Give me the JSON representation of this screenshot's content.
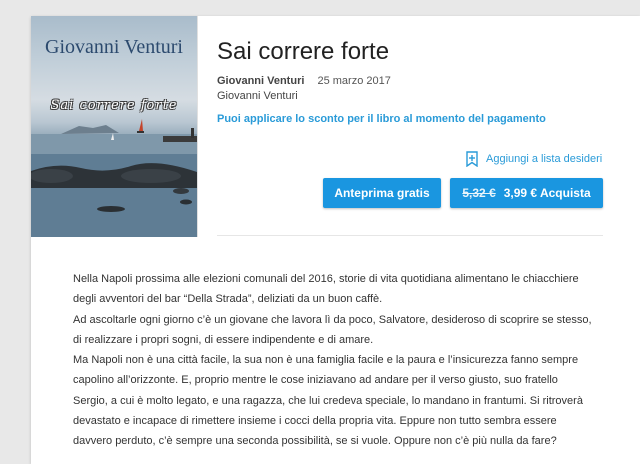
{
  "book": {
    "cover": {
      "author": "Giovanni Venturi",
      "title": "Sai correre forte"
    },
    "title": "Sai correre forte",
    "author": "Giovanni Venturi",
    "date": "25 marzo 2017",
    "publisher": "Giovanni Venturi",
    "promo": "Puoi applicare lo sconto per il libro al momento del pagamento"
  },
  "actions": {
    "wishlist": "Aggiungi a lista desideri",
    "preview": "Anteprima gratis",
    "old_price": "5,32 €",
    "buy": "3,99 € Acquista"
  },
  "description": [
    "Nella Napoli prossima alle elezioni comunali del 2016, storie di vita quotidiana alimentano le chiacchiere degli avventori del bar “Della Strada”, deliziati da un buon caffè.",
    "Ad ascoltarle ogni giorno c’è un giovane che lavora lì da poco, Salvatore, desideroso di scoprire se stesso, di realizzare i propri sogni, di essere indipendente e di amare.",
    "Ma Napoli non è una città facile, la sua non è una famiglia facile e la paura e l’insicurezza fanno sempre capolino all’orizzonte. E, proprio mentre le cose iniziavano ad andare per il verso giusto, suo fratello Sergio, a cui è molto legato, e una ragazza, che lui credeva speciale, lo mandano in frantumi. Si ritroverà devastato e incapace di rimettere insieme i cocci della propria vita. Eppure non tutto sembra essere davvero perduto, c’è sempre una seconda possibilità, se si vuole. Oppure non c’è più nulla da fare?"
  ],
  "colors": {
    "accent": "#1a96e0",
    "link": "#2a9bd8"
  }
}
